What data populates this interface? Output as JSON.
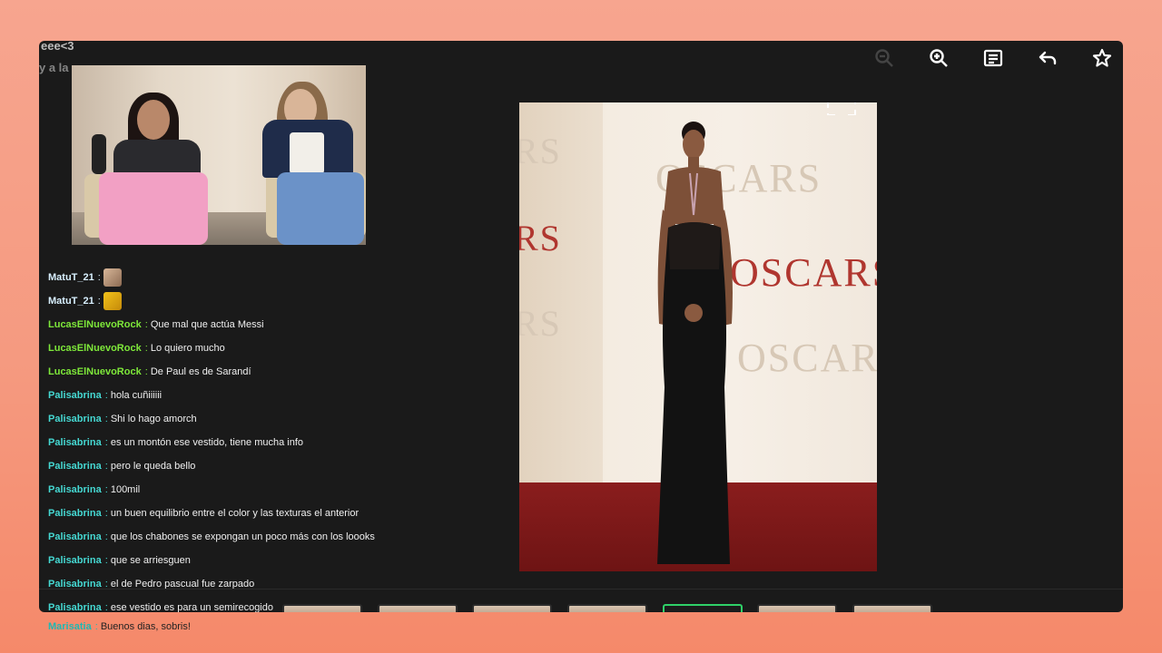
{
  "ghost_text": {
    "line1": "eee<3",
    "line2": "y a la"
  },
  "toolbar": {
    "icons": [
      "zoom-out-icon",
      "zoom-in-icon",
      "chat-icon",
      "reply-icon",
      "star-icon"
    ]
  },
  "chat": {
    "messages": [
      {
        "user": "MatuT_21",
        "text": "",
        "color": "#d8f0ff",
        "emote": "emote-1"
      },
      {
        "user": "MatuT_21",
        "text": "",
        "color": "#d8f0ff",
        "emote": "emote-2"
      },
      {
        "user": "LucasElNuevoRock",
        "text": "Que mal que actúa Messi",
        "color": "#7ee83a"
      },
      {
        "user": "LucasElNuevoRock",
        "text": "Lo quiero mucho",
        "color": "#7ee83a"
      },
      {
        "user": "LucasElNuevoRock",
        "text": "De Paul es de Sarandí",
        "color": "#7ee83a"
      },
      {
        "user": "Palisabrina",
        "text": "hola cuñiiiiii",
        "color": "#45d8d2"
      },
      {
        "user": "Palisabrina",
        "text": "Shi lo hago amorch",
        "color": "#45d8d2"
      },
      {
        "user": "Palisabrina",
        "text": "es un montón ese vestido, tiene mucha info",
        "color": "#45d8d2"
      },
      {
        "user": "Palisabrina",
        "text": "pero le queda bello",
        "color": "#45d8d2"
      },
      {
        "user": "Palisabrina",
        "text": "100mil",
        "color": "#45d8d2"
      },
      {
        "user": "Palisabrina",
        "text": "un buen equilibrio entre el color y las texturas el anterior",
        "color": "#45d8d2"
      },
      {
        "user": "Palisabrina",
        "text": "que los chabones se expongan un poco más con los loooks",
        "color": "#45d8d2"
      },
      {
        "user": "Palisabrina",
        "text": "que se arriesguen",
        "color": "#45d8d2"
      },
      {
        "user": "Palisabrina",
        "text": "el de Pedro pascual fue zarpado",
        "color": "#45d8d2"
      },
      {
        "user": "Palisabrina",
        "text": "ese vestido es para un semirecogido",
        "color": "#45d8d2"
      }
    ],
    "bottom": {
      "user": "Marisatia",
      "text": "Buenos dias, sobris!"
    }
  },
  "photo": {
    "backdrop_words": [
      "OSCARS",
      "OSCARS",
      "OSCARS"
    ],
    "left_words": [
      "RS",
      "RS",
      "RS"
    ]
  },
  "colors": {
    "accent_green": "#2fd168",
    "panel_bg": "#1a1a1a"
  }
}
